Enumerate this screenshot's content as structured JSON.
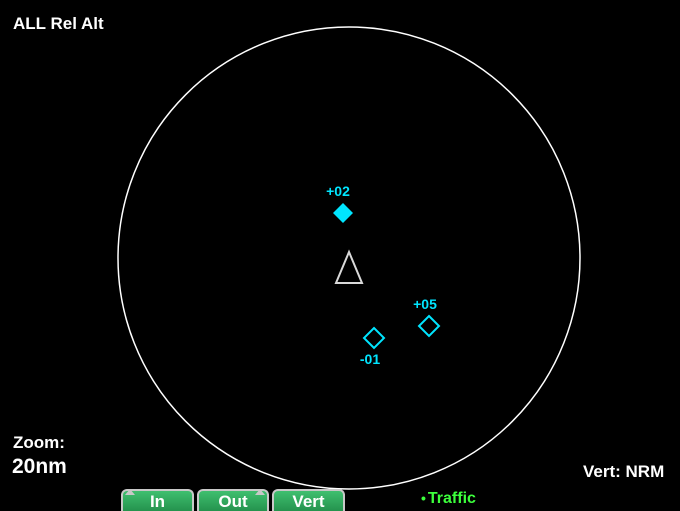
{
  "display": {
    "mode_label": "ALL Rel Alt",
    "zoom_caption": "Zoom:",
    "zoom_value": "20nm",
    "vert_status": "Vert: NRM"
  },
  "targets": [
    {
      "label": "+02",
      "style": "filled",
      "color": "#00e5ff"
    },
    {
      "label": "+05",
      "style": "hollow",
      "color": "#00e5ff"
    },
    {
      "label": "-01",
      "style": "hollow",
      "color": "#00e5ff"
    }
  ],
  "softkeys": {
    "in_label": "In",
    "out_label": "Out",
    "vert_label": "Vert",
    "key_color": "#2aa85a"
  },
  "page_indicator": {
    "label": "Traffic",
    "color": "#3cff3c"
  },
  "colors": {
    "background": "#000000",
    "range_ring": "#ffffff",
    "ownship": "#ffffff",
    "traffic": "#00e5ff"
  }
}
